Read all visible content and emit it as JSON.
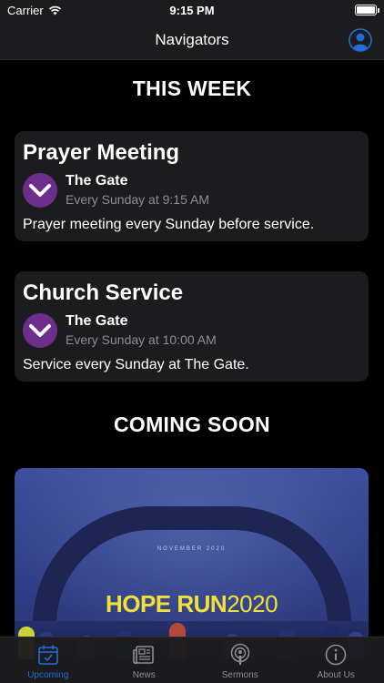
{
  "status_bar": {
    "carrier": "Carrier",
    "time": "9:15 PM",
    "battery_level": 1.0
  },
  "nav": {
    "title": "Navigators",
    "profile_icon": "person-circle-icon"
  },
  "sections": {
    "this_week": "THIS WEEK",
    "coming_soon": "COMING SOON"
  },
  "events": [
    {
      "title": "Prayer Meeting",
      "org": "The Gate",
      "schedule": "Every Sunday at 9:15 AM",
      "description": "Prayer meeting every Sunday before service."
    },
    {
      "title": "Church Service",
      "org": "The Gate",
      "schedule": "Every Sunday at 10:00 AM",
      "description": "Service every Sunday at The Gate."
    }
  ],
  "banner": {
    "subtitle": "NOVEMBER 2020",
    "logo_bold": "HOPE RUN",
    "logo_year": "2020"
  },
  "tabs": [
    {
      "label": "Upcoming",
      "icon": "calendar-icon",
      "active": true
    },
    {
      "label": "News",
      "icon": "newspaper-icon",
      "active": false
    },
    {
      "label": "Sermons",
      "icon": "podcast-icon",
      "active": false
    },
    {
      "label": "About Us",
      "icon": "info-icon",
      "active": false
    }
  ],
  "colors": {
    "accent": "#1e6fd9",
    "card_bg": "#1c1c1e",
    "logo_purple": "#6b2e8a",
    "banner_yellow": "#f3e13a"
  }
}
